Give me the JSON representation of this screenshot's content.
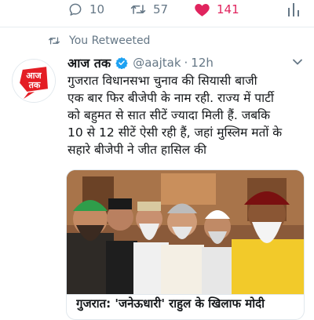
{
  "actions": {
    "reply_count": "10",
    "retweet_count": "57",
    "like_count": "141",
    "reply_icon": "reply-bubble-icon",
    "retweet_icon": "retweet-icon",
    "like_icon": "heart-icon",
    "analytics_icon": "analytics-bars-icon"
  },
  "retweet_context": {
    "label": "You Retweeted",
    "icon": "retweet-icon"
  },
  "tweet": {
    "display_name": "आज तक",
    "handle": "@aajtak",
    "separator": "·",
    "time": "12h",
    "verified": true,
    "text": "गुजरात विधानसभा चुनाव की सियासी बाजी\nएक बार फिर बीजेपी के नाम रही. राज्य में पार्टी\nको बहुमत से सात सीटें ज्यादा मिली हैं. जबकि\n10 से 12 सीटें ऐसी रही हैं, जहां मुस्लिम मतों के\nसहारे बीजेपी ने जीत हासिल की",
    "avatar_logo_text": "आज तक"
  },
  "card": {
    "title": "गुजरात: 'जनेऊधारी' राहुल के खिलाफ मोदी"
  },
  "colors": {
    "like": "#e0245e",
    "secondary_text": "#657786",
    "verified": "#1da1f2",
    "logo_red": "#e41d24"
  }
}
